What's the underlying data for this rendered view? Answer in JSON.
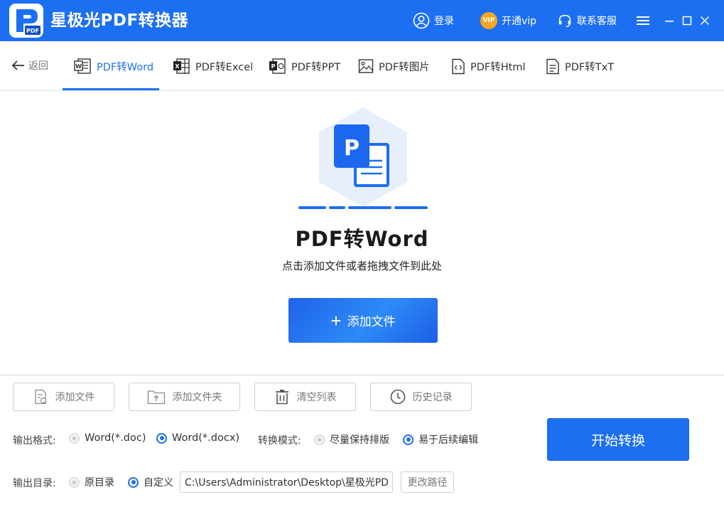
{
  "app": {
    "title": "星极光PDF转换器",
    "logo_text": "PDF",
    "login": "登录",
    "vip_badge": "VIP",
    "vip": "开通vip",
    "service": "联系客服"
  },
  "nav": {
    "back": "返回",
    "tabs": [
      {
        "label": "PDF转Word",
        "icon": "word-file-icon",
        "active": true
      },
      {
        "label": "PDF转Excel",
        "icon": "excel-file-icon",
        "active": false
      },
      {
        "label": "PDF转PPT",
        "icon": "ppt-file-icon",
        "active": false
      },
      {
        "label": "PDF转图片",
        "icon": "image-file-icon",
        "active": false
      },
      {
        "label": "PDF转Html",
        "icon": "html-file-icon",
        "active": false
      },
      {
        "label": "PDF转TxT",
        "icon": "txt-file-icon",
        "active": false
      }
    ]
  },
  "drop": {
    "icon_letter": "P",
    "title": "PDF转Word",
    "subtitle": "点击添加文件或者拖拽文件到此处",
    "add_button": "添加文件"
  },
  "toolbar": {
    "add_file": "添加文件",
    "add_folder": "添加文件夹",
    "clear_list": "清空列表",
    "history": "历史记录"
  },
  "options": {
    "format_label": "输出格式:",
    "format_doc": "Word(*.doc)",
    "format_docx": "Word(*.docx)",
    "selected_format": "docx",
    "mode_label": "转换模式:",
    "mode_layout": "尽量保持排版",
    "mode_edit": "易于后续编辑",
    "selected_mode": "edit",
    "dir_label": "输出目录:",
    "dir_original": "原目录",
    "dir_custom": "自定义",
    "selected_dir": "custom",
    "path": "C:\\Users\\Administrator\\Desktop\\星极光PDF转",
    "change_path": "更改路径"
  },
  "start_button": "开始转换",
  "colors": {
    "primary": "#1d6ff1",
    "vip": "#f6a623"
  }
}
